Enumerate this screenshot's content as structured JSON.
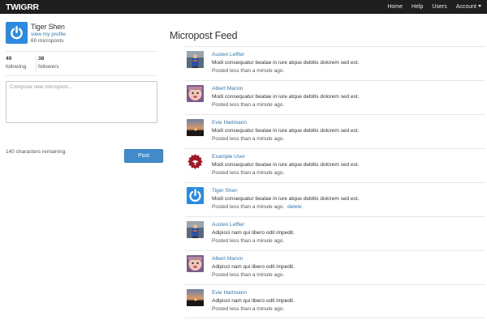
{
  "navbar": {
    "brand": "TWIGRR",
    "links": {
      "home": "Home",
      "help": "Help",
      "users": "Users",
      "account": "Account"
    }
  },
  "sidebar": {
    "name": "Tiger Shen",
    "profile_link": "view my profile",
    "micropost_count": "60 microposts",
    "following_count": "49",
    "following_label": "following",
    "followers_count": "38",
    "followers_label": "followers",
    "composer_placeholder": "Compose new micropost...",
    "chars_remaining": "140 characters remaining.",
    "post_button": "Post"
  },
  "feed": {
    "title": "Micropost Feed",
    "items": [
      {
        "author": "Austen Leffler",
        "content": "Modi consequatur beatae in iure atque debitis dolorem sed est.",
        "timestamp": "Posted less than a minute ago.",
        "avatar_icon": "austen-avatar"
      },
      {
        "author": "Albert Marvin",
        "content": "Modi consequatur beatae in iure atque debitis dolorem sed est.",
        "timestamp": "Posted less than a minute ago.",
        "avatar_icon": "baby-avatar"
      },
      {
        "author": "Evie Hartmann",
        "content": "Modi consequatur beatae in iure atque debitis dolorem sed est.",
        "timestamp": "Posted less than a minute ago.",
        "avatar_icon": "sunset-avatar"
      },
      {
        "author": "Example User",
        "content": "Modi consequatur beatae in iure atque debitis dolorem sed est.",
        "timestamp": "Posted less than a minute ago.",
        "avatar_icon": "red-badge-avatar"
      },
      {
        "author": "Tiger Shen",
        "content": "Modi consequatur beatae in iure atque debitis dolorem sed est.",
        "timestamp": "Posted less than a minute ago.",
        "delete_label": "delete",
        "avatar_icon": "power-avatar"
      },
      {
        "author": "Austen Leffler",
        "content": "Adipisci nam qui libero odit impedit.",
        "timestamp": "Posted less than a minute ago.",
        "avatar_icon": "austen-avatar"
      },
      {
        "author": "Albert Marvin",
        "content": "Adipisci nam qui libero odit impedit.",
        "timestamp": "Posted less than a minute ago.",
        "avatar_icon": "baby-avatar"
      },
      {
        "author": "Evie Hartmann",
        "content": "Adipisci nam qui libero odit impedit.",
        "timestamp": "Posted less than a minute ago.",
        "avatar_icon": "sunset-avatar"
      }
    ]
  },
  "colors": {
    "navbar": "#1f1f1f",
    "link": "#337ab7",
    "button": "#428bca",
    "avatar_blue": "#2a8be0"
  }
}
